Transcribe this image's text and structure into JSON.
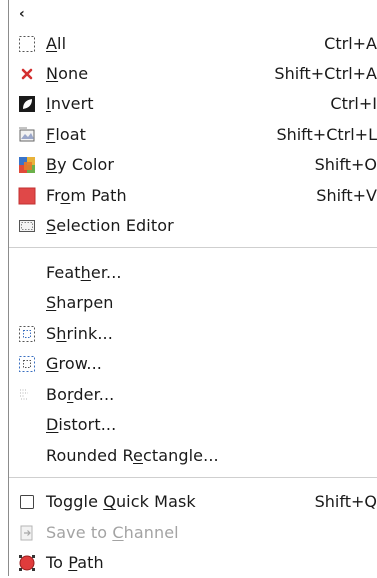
{
  "back": {
    "glyph": "‹"
  },
  "items": [
    {
      "id": "all",
      "pre": "",
      "mn": "A",
      "post": "ll",
      "shortcut": "Ctrl+A",
      "icon": "select-all-icon"
    },
    {
      "id": "none",
      "pre": "",
      "mn": "N",
      "post": "one",
      "shortcut": "Shift+Ctrl+A",
      "icon": "select-none-icon"
    },
    {
      "id": "invert",
      "pre": "",
      "mn": "I",
      "post": "nvert",
      "shortcut": "Ctrl+I",
      "icon": "invert-selection-icon"
    },
    {
      "id": "float",
      "pre": "",
      "mn": "F",
      "post": "loat",
      "shortcut": "Shift+Ctrl+L",
      "icon": "float-selection-icon"
    },
    {
      "id": "by-color",
      "pre": "",
      "mn": "B",
      "post": "y Color",
      "shortcut": "Shift+O",
      "icon": "select-by-color-icon"
    },
    {
      "id": "from-path",
      "pre": "Fr",
      "mn": "o",
      "post": "m Path",
      "shortcut": "Shift+V",
      "icon": "selection-from-path-icon"
    },
    {
      "id": "selection-editor",
      "pre": "",
      "mn": "S",
      "post": "election Editor",
      "shortcut": "",
      "icon": "selection-editor-icon"
    },
    {
      "id": "feather",
      "pre": "Feat",
      "mn": "h",
      "post": "er...",
      "shortcut": "",
      "icon": ""
    },
    {
      "id": "sharpen",
      "pre": "",
      "mn": "S",
      "post": "harpen",
      "shortcut": "",
      "icon": ""
    },
    {
      "id": "shrink",
      "pre": "S",
      "mn": "h",
      "post": "rink...",
      "shortcut": "",
      "icon": "shrink-selection-icon"
    },
    {
      "id": "grow",
      "pre": "",
      "mn": "G",
      "post": "row...",
      "shortcut": "",
      "icon": "grow-selection-icon"
    },
    {
      "id": "border",
      "pre": "Bo",
      "mn": "r",
      "post": "der...",
      "shortcut": "",
      "icon": "border-selection-icon"
    },
    {
      "id": "distort",
      "pre": "",
      "mn": "D",
      "post": "istort...",
      "shortcut": "",
      "icon": ""
    },
    {
      "id": "rounded-rectangle",
      "pre": "Rounded R",
      "mn": "e",
      "post": "ctangle...",
      "shortcut": "",
      "icon": ""
    },
    {
      "id": "toggle-quick-mask",
      "pre": "Toggle ",
      "mn": "Q",
      "post": "uick Mask",
      "shortcut": "Shift+Q",
      "icon": "checkbox-icon",
      "disabled": false
    },
    {
      "id": "save-to-channel",
      "pre": "Save to ",
      "mn": "C",
      "post": "hannel",
      "shortcut": "",
      "icon": "save-to-channel-icon",
      "disabled": true
    },
    {
      "id": "to-path",
      "pre": "To ",
      "mn": "P",
      "post": "ath",
      "shortcut": "",
      "icon": "selection-to-path-icon"
    }
  ],
  "colors": {
    "separator": "#cfcfcf",
    "disabled_text": "#a3a3a3",
    "red": "#e03c3c"
  }
}
